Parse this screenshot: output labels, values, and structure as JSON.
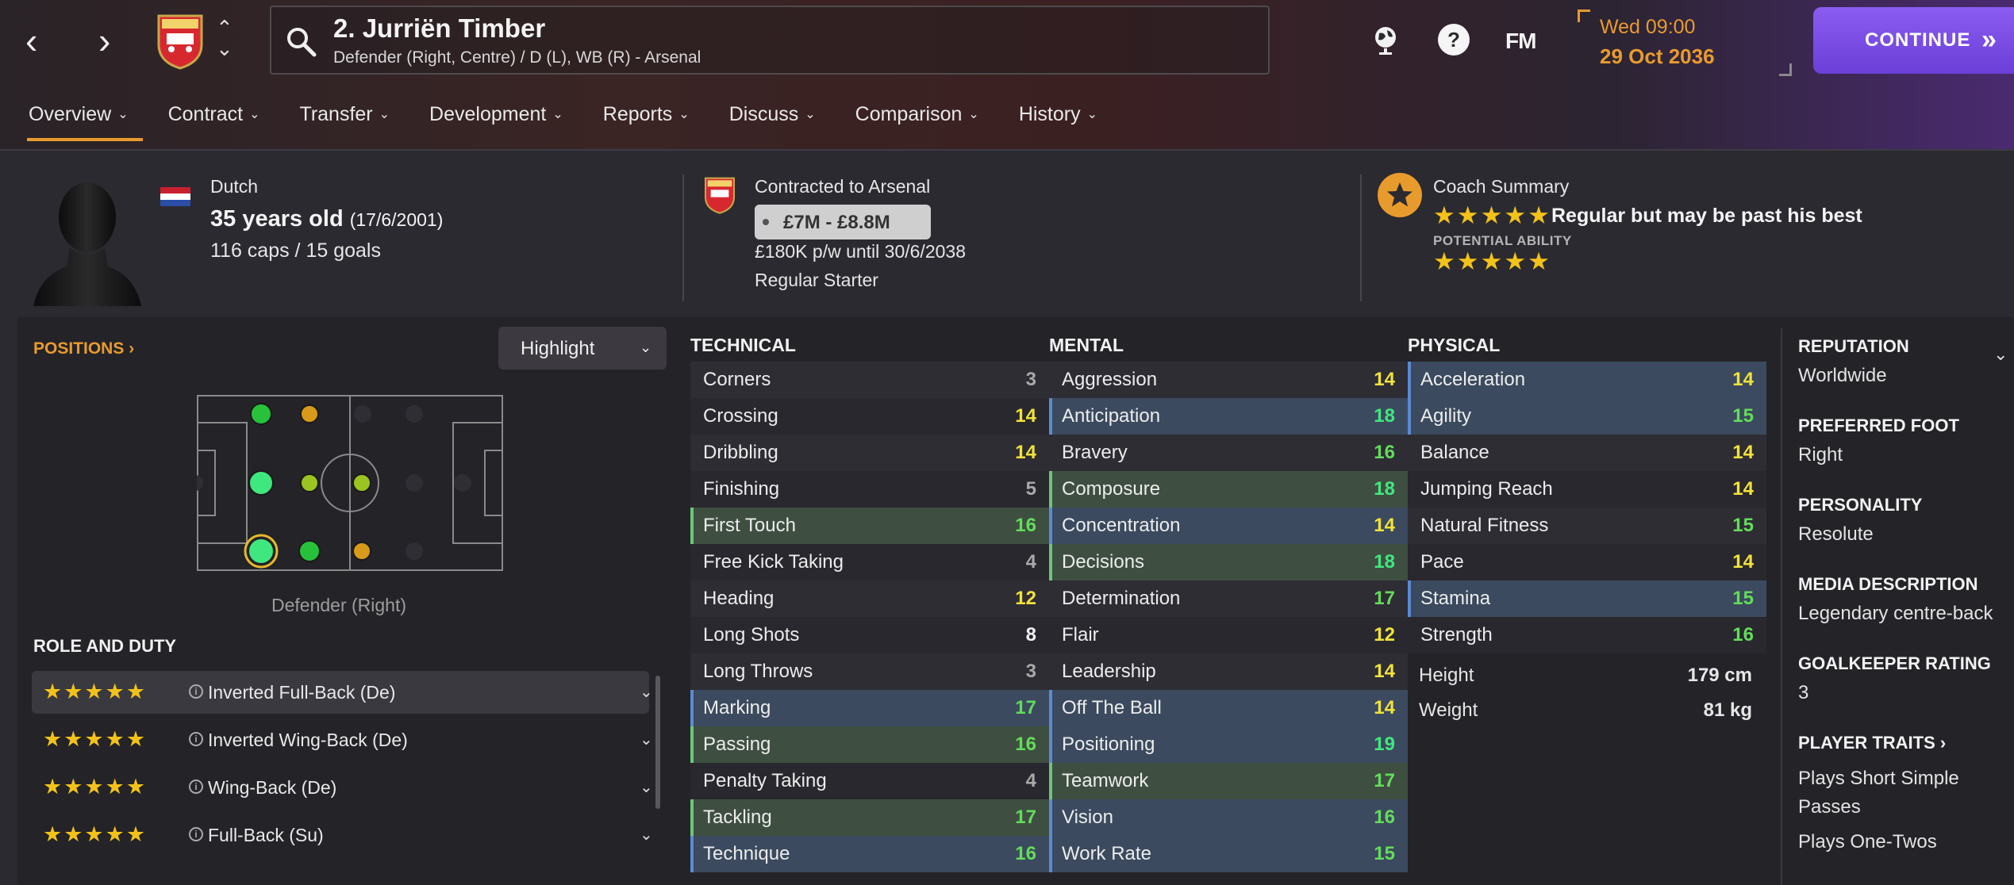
{
  "header": {
    "player_name": "2. Jurriën Timber",
    "player_subtitle": "Defender (Right, Centre) / D (L), WB (R) - Arsenal",
    "fm_label": "FM",
    "date_line1": "Wed 09:00",
    "date_line2": "29 Oct 2036",
    "continue_label": "CONTINUE"
  },
  "tabs": [
    {
      "label": "Overview",
      "active": true
    },
    {
      "label": "Contract"
    },
    {
      "label": "Transfer"
    },
    {
      "label": "Development"
    },
    {
      "label": "Reports"
    },
    {
      "label": "Discuss"
    },
    {
      "label": "Comparison"
    },
    {
      "label": "History"
    }
  ],
  "summary": {
    "nationality": "Dutch",
    "age": "35 years old",
    "dob": "(17/6/2001)",
    "caps": "116 caps / 15 goals",
    "contracted": "Contracted to Arsenal",
    "value": "£7M - £8.8M",
    "wage": "£180K p/w until 30/6/2038",
    "squad_status": "Regular Starter",
    "coach_title": "Coach Summary",
    "coach_verdict": "Regular but may be past his best",
    "pa_label": "POTENTIAL ABILITY",
    "current_stars": "★★★★★",
    "potential_stars": "★★★★★"
  },
  "positions": {
    "label": "POSITIONS",
    "highlight_label": "Highlight",
    "position_name": "Defender (Right)"
  },
  "roles": {
    "title": "ROLE AND DUTY",
    "items": [
      {
        "stars": "★★★★★",
        "name": "Inverted Full-Back (De)"
      },
      {
        "stars": "★★★★★",
        "name": "Inverted Wing-Back (De)"
      },
      {
        "stars": "★★★★★",
        "name": "Wing-Back (De)"
      },
      {
        "stars": "★★★★★",
        "name": "Full-Back (Su)"
      }
    ]
  },
  "technical": {
    "title": "TECHNICAL",
    "attrs": [
      {
        "name": "Corners",
        "value": "3",
        "hl": ""
      },
      {
        "name": "Crossing",
        "value": "14",
        "hl": ""
      },
      {
        "name": "Dribbling",
        "value": "14",
        "hl": ""
      },
      {
        "name": "Finishing",
        "value": "5",
        "hl": ""
      },
      {
        "name": "First Touch",
        "value": "16",
        "hl": "green"
      },
      {
        "name": "Free Kick Taking",
        "value": "4",
        "hl": ""
      },
      {
        "name": "Heading",
        "value": "12",
        "hl": ""
      },
      {
        "name": "Long Shots",
        "value": "8",
        "hl": ""
      },
      {
        "name": "Long Throws",
        "value": "3",
        "hl": ""
      },
      {
        "name": "Marking",
        "value": "17",
        "hl": "blue"
      },
      {
        "name": "Passing",
        "value": "16",
        "hl": "green"
      },
      {
        "name": "Penalty Taking",
        "value": "4",
        "hl": ""
      },
      {
        "name": "Tackling",
        "value": "17",
        "hl": "green"
      },
      {
        "name": "Technique",
        "value": "16",
        "hl": "blue"
      }
    ]
  },
  "mental": {
    "title": "MENTAL",
    "attrs": [
      {
        "name": "Aggression",
        "value": "14",
        "hl": ""
      },
      {
        "name": "Anticipation",
        "value": "18",
        "hl": "blue"
      },
      {
        "name": "Bravery",
        "value": "16",
        "hl": ""
      },
      {
        "name": "Composure",
        "value": "18",
        "hl": "green"
      },
      {
        "name": "Concentration",
        "value": "14",
        "hl": "blue"
      },
      {
        "name": "Decisions",
        "value": "18",
        "hl": "green"
      },
      {
        "name": "Determination",
        "value": "17",
        "hl": ""
      },
      {
        "name": "Flair",
        "value": "12",
        "hl": ""
      },
      {
        "name": "Leadership",
        "value": "14",
        "hl": ""
      },
      {
        "name": "Off The Ball",
        "value": "14",
        "hl": "blue"
      },
      {
        "name": "Positioning",
        "value": "19",
        "hl": "blue"
      },
      {
        "name": "Teamwork",
        "value": "17",
        "hl": "green"
      },
      {
        "name": "Vision",
        "value": "16",
        "hl": "blue"
      },
      {
        "name": "Work Rate",
        "value": "15",
        "hl": "blue"
      }
    ]
  },
  "physical": {
    "title": "PHYSICAL",
    "attrs": [
      {
        "name": "Acceleration",
        "value": "14",
        "hl": "blue"
      },
      {
        "name": "Agility",
        "value": "15",
        "hl": "blue"
      },
      {
        "name": "Balance",
        "value": "14",
        "hl": ""
      },
      {
        "name": "Jumping Reach",
        "value": "14",
        "hl": ""
      },
      {
        "name": "Natural Fitness",
        "value": "15",
        "hl": ""
      },
      {
        "name": "Pace",
        "value": "14",
        "hl": ""
      },
      {
        "name": "Stamina",
        "value": "15",
        "hl": "blue"
      },
      {
        "name": "Strength",
        "value": "16",
        "hl": ""
      }
    ],
    "height_label": "Height",
    "height_value": "179 cm",
    "weight_label": "Weight",
    "weight_value": "81 kg"
  },
  "info": {
    "reputation_label": "REPUTATION",
    "reputation_value": "Worldwide",
    "foot_label": "PREFERRED FOOT",
    "foot_value": "Right",
    "personality_label": "PERSONALITY",
    "personality_value": "Resolute",
    "media_label": "MEDIA DESCRIPTION",
    "media_value": "Legendary centre-back",
    "gk_label": "GOALKEEPER RATING",
    "gk_value": "3",
    "traits_label": "PLAYER TRAITS",
    "traits": [
      "Plays Short Simple",
      "Passes",
      "Plays One-Twos"
    ]
  },
  "colors": {
    "accent": "#e89b2d",
    "continue": "#7b4ce6",
    "highlight_blue": "#3b4a5e",
    "highlight_green": "#3e4f41"
  }
}
